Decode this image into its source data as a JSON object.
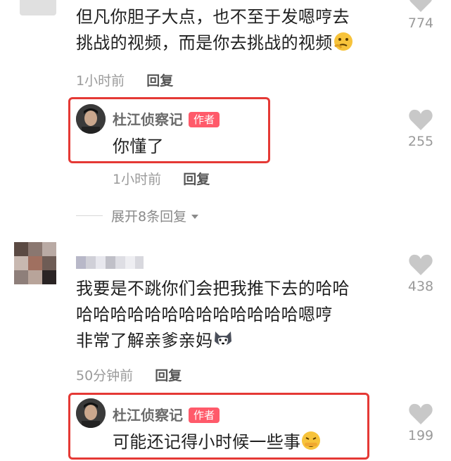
{
  "c1": {
    "line1": "但凡你胆子大点，也不至于发嗯哼去",
    "line2": "挑战的视频，而是你去挑战的视频",
    "time": "1小时前",
    "reply": "回复",
    "likes": "774"
  },
  "r1": {
    "author": "杜江侦察记",
    "tag": "作者",
    "text": "你懂了",
    "time": "1小时前",
    "reply": "回复",
    "likes": "255"
  },
  "expand": {
    "label": "展开8条回复"
  },
  "c2": {
    "line1": "我要是不跳你们会把我推下去的哈哈",
    "line2": "哈哈哈哈哈哈哈哈哈哈哈哈哈嗯哼",
    "line3": "非常了解亲爹亲妈",
    "time": "50分钟前",
    "reply": "回复",
    "likes": "438"
  },
  "r2": {
    "author": "杜江侦察记",
    "tag": "作者",
    "text": "可能还记得小时候一些事",
    "likes": "199"
  },
  "colors": {
    "highlight": "#e53935",
    "author_tag": "#ff5a6a",
    "heart": "#c8c8c8"
  },
  "icons": [
    "heart-icon",
    "thinking-emoji",
    "husky-emoji",
    "shush-emoji",
    "caret-down-icon"
  ]
}
